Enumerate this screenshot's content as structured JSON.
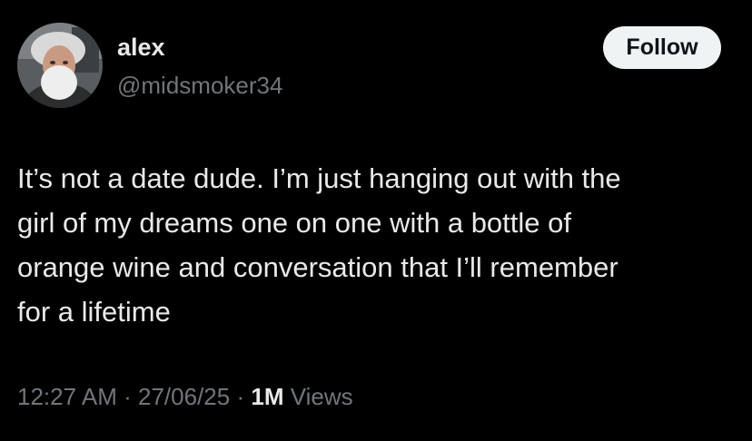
{
  "author": {
    "display_name": "alex",
    "handle": "@midsmoker34",
    "avatar_icon": "profile-photo"
  },
  "follow_button": {
    "label": "Follow"
  },
  "tweet": {
    "lines": [
      "It’s not a date dude. I’m just hanging out with the",
      "girl of my dreams one on one with a bottle of",
      "orange wine and conversation that I’ll remember",
      "for a lifetime"
    ]
  },
  "meta": {
    "time": "12:27 AM",
    "separator": "·",
    "date": "27/06/25",
    "views_count": "1M",
    "views_label": "Views"
  },
  "colors": {
    "background": "#000000",
    "primary_text": "#e7e9ea",
    "secondary_text": "#71767b",
    "button_bg": "#eff3f4",
    "button_text": "#0f1419"
  }
}
